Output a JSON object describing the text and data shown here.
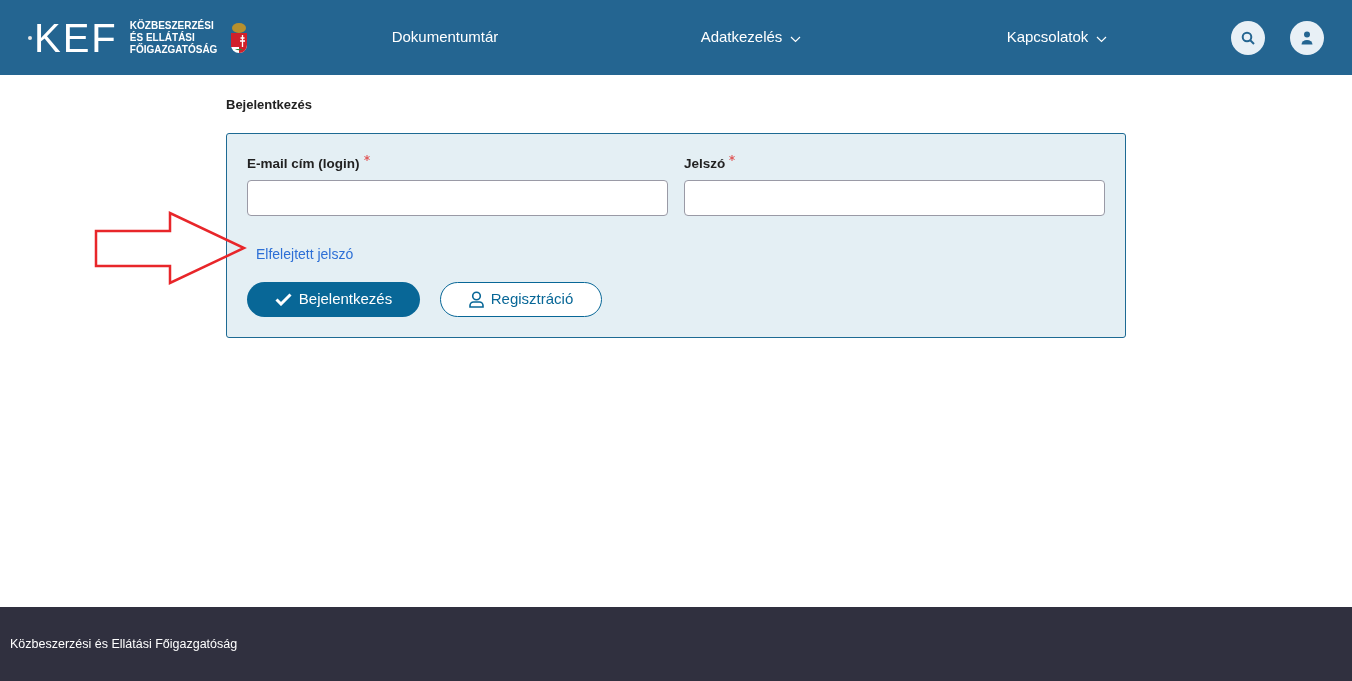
{
  "header": {
    "logo": {
      "mark": "KEF",
      "lines": [
        "KÖZBESZERZÉSI",
        "ÉS ELLÁTÁSI",
        "FŐIGAZGATÓSÁG"
      ]
    },
    "nav": [
      {
        "label": "Dokumentumtár",
        "has_menu": false
      },
      {
        "label": "Adatkezelés",
        "has_menu": true
      },
      {
        "label": "Kapcsolatok",
        "has_menu": true
      }
    ]
  },
  "page_title": "Bejelentkezés",
  "form": {
    "fields": [
      {
        "label": "E-mail cím (login)",
        "required": true
      },
      {
        "label": "Jelszó",
        "required": true
      }
    ],
    "forgot_link": "Elfelejtett jelszó",
    "buttons": [
      {
        "kind": "primary",
        "label": "Bejelentkezés"
      },
      {
        "kind": "secondary",
        "label": "Regisztráció"
      }
    ]
  },
  "annotation": {
    "kind": "arrow"
  },
  "footer": {
    "text": "Közbeszerzési és Ellátási Főigazgatóság"
  }
}
